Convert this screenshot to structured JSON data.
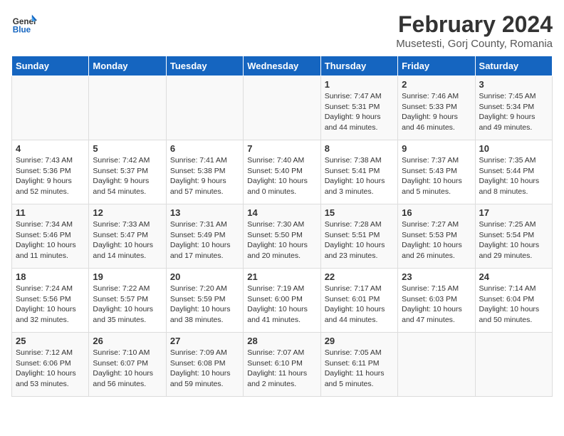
{
  "header": {
    "logo_general": "General",
    "logo_blue": "Blue",
    "title": "February 2024",
    "subtitle": "Musetesti, Gorj County, Romania"
  },
  "columns": [
    "Sunday",
    "Monday",
    "Tuesday",
    "Wednesday",
    "Thursday",
    "Friday",
    "Saturday"
  ],
  "weeks": [
    [
      {
        "day": "",
        "info": ""
      },
      {
        "day": "",
        "info": ""
      },
      {
        "day": "",
        "info": ""
      },
      {
        "day": "",
        "info": ""
      },
      {
        "day": "1",
        "info": "Sunrise: 7:47 AM\nSunset: 5:31 PM\nDaylight: 9 hours\nand 44 minutes."
      },
      {
        "day": "2",
        "info": "Sunrise: 7:46 AM\nSunset: 5:33 PM\nDaylight: 9 hours\nand 46 minutes."
      },
      {
        "day": "3",
        "info": "Sunrise: 7:45 AM\nSunset: 5:34 PM\nDaylight: 9 hours\nand 49 minutes."
      }
    ],
    [
      {
        "day": "4",
        "info": "Sunrise: 7:43 AM\nSunset: 5:36 PM\nDaylight: 9 hours\nand 52 minutes."
      },
      {
        "day": "5",
        "info": "Sunrise: 7:42 AM\nSunset: 5:37 PM\nDaylight: 9 hours\nand 54 minutes."
      },
      {
        "day": "6",
        "info": "Sunrise: 7:41 AM\nSunset: 5:38 PM\nDaylight: 9 hours\nand 57 minutes."
      },
      {
        "day": "7",
        "info": "Sunrise: 7:40 AM\nSunset: 5:40 PM\nDaylight: 10 hours\nand 0 minutes."
      },
      {
        "day": "8",
        "info": "Sunrise: 7:38 AM\nSunset: 5:41 PM\nDaylight: 10 hours\nand 3 minutes."
      },
      {
        "day": "9",
        "info": "Sunrise: 7:37 AM\nSunset: 5:43 PM\nDaylight: 10 hours\nand 5 minutes."
      },
      {
        "day": "10",
        "info": "Sunrise: 7:35 AM\nSunset: 5:44 PM\nDaylight: 10 hours\nand 8 minutes."
      }
    ],
    [
      {
        "day": "11",
        "info": "Sunrise: 7:34 AM\nSunset: 5:46 PM\nDaylight: 10 hours\nand 11 minutes."
      },
      {
        "day": "12",
        "info": "Sunrise: 7:33 AM\nSunset: 5:47 PM\nDaylight: 10 hours\nand 14 minutes."
      },
      {
        "day": "13",
        "info": "Sunrise: 7:31 AM\nSunset: 5:49 PM\nDaylight: 10 hours\nand 17 minutes."
      },
      {
        "day": "14",
        "info": "Sunrise: 7:30 AM\nSunset: 5:50 PM\nDaylight: 10 hours\nand 20 minutes."
      },
      {
        "day": "15",
        "info": "Sunrise: 7:28 AM\nSunset: 5:51 PM\nDaylight: 10 hours\nand 23 minutes."
      },
      {
        "day": "16",
        "info": "Sunrise: 7:27 AM\nSunset: 5:53 PM\nDaylight: 10 hours\nand 26 minutes."
      },
      {
        "day": "17",
        "info": "Sunrise: 7:25 AM\nSunset: 5:54 PM\nDaylight: 10 hours\nand 29 minutes."
      }
    ],
    [
      {
        "day": "18",
        "info": "Sunrise: 7:24 AM\nSunset: 5:56 PM\nDaylight: 10 hours\nand 32 minutes."
      },
      {
        "day": "19",
        "info": "Sunrise: 7:22 AM\nSunset: 5:57 PM\nDaylight: 10 hours\nand 35 minutes."
      },
      {
        "day": "20",
        "info": "Sunrise: 7:20 AM\nSunset: 5:59 PM\nDaylight: 10 hours\nand 38 minutes."
      },
      {
        "day": "21",
        "info": "Sunrise: 7:19 AM\nSunset: 6:00 PM\nDaylight: 10 hours\nand 41 minutes."
      },
      {
        "day": "22",
        "info": "Sunrise: 7:17 AM\nSunset: 6:01 PM\nDaylight: 10 hours\nand 44 minutes."
      },
      {
        "day": "23",
        "info": "Sunrise: 7:15 AM\nSunset: 6:03 PM\nDaylight: 10 hours\nand 47 minutes."
      },
      {
        "day": "24",
        "info": "Sunrise: 7:14 AM\nSunset: 6:04 PM\nDaylight: 10 hours\nand 50 minutes."
      }
    ],
    [
      {
        "day": "25",
        "info": "Sunrise: 7:12 AM\nSunset: 6:06 PM\nDaylight: 10 hours\nand 53 minutes."
      },
      {
        "day": "26",
        "info": "Sunrise: 7:10 AM\nSunset: 6:07 PM\nDaylight: 10 hours\nand 56 minutes."
      },
      {
        "day": "27",
        "info": "Sunrise: 7:09 AM\nSunset: 6:08 PM\nDaylight: 10 hours\nand 59 minutes."
      },
      {
        "day": "28",
        "info": "Sunrise: 7:07 AM\nSunset: 6:10 PM\nDaylight: 11 hours\nand 2 minutes."
      },
      {
        "day": "29",
        "info": "Sunrise: 7:05 AM\nSunset: 6:11 PM\nDaylight: 11 hours\nand 5 minutes."
      },
      {
        "day": "",
        "info": ""
      },
      {
        "day": "",
        "info": ""
      }
    ]
  ]
}
